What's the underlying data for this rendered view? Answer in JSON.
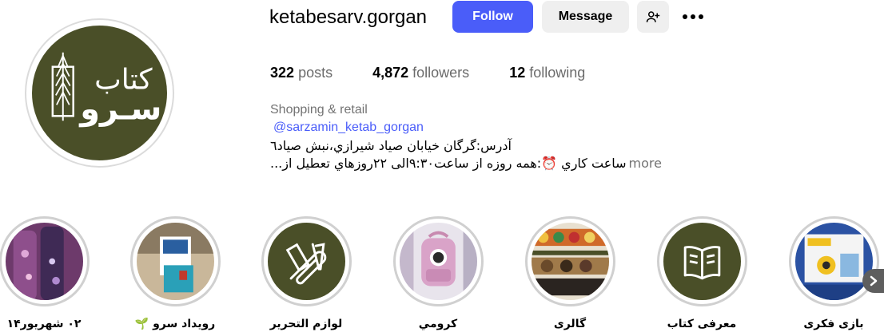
{
  "profile": {
    "username": "ketabesarv.gorgan",
    "follow_label": "Follow",
    "message_label": "Message",
    "posts_count": "322",
    "posts_label": "posts",
    "followers_count": "4,872",
    "followers_label": "followers",
    "following_count": "12",
    "following_label": "following",
    "category": "Shopping & retail",
    "mention": "@sarzamin_ketab_gorgan",
    "bio_line1": "آدرس:گرگان خیابان صیاد شیرازي،نبش صیاد٦",
    "bio_line2": "...ساعت کاري ⏰:همه روزه از ساعت٩:٣٠الی ٢٢روزهاي تعطیل از",
    "more_label": "more",
    "avatar_logo_text": "کتاب سرو"
  },
  "highlights": [
    {
      "label": "١۴٠٢ شهریور",
      "color": "#7b3f7a"
    },
    {
      "label": "🌱 رویداد سرو",
      "color": "#5a8fb6"
    },
    {
      "label": "لوازم التحریر",
      "color": "#4a4f28"
    },
    {
      "label": "کرومي",
      "color": "#d8a6c4"
    },
    {
      "label": "گالری",
      "color": "#8a6a3c"
    },
    {
      "label": "معرفی کتاب",
      "color": "#4a4f28"
    },
    {
      "label": "بازی فکری",
      "color": "#2b52a3"
    }
  ],
  "icons": {
    "add_user": "person-add-icon",
    "more": "more-options-icon",
    "next": "chevron-right-icon"
  },
  "colors": {
    "accent": "#4a5df9",
    "brand_green": "#4a4f28",
    "button_grey": "#efefef"
  }
}
